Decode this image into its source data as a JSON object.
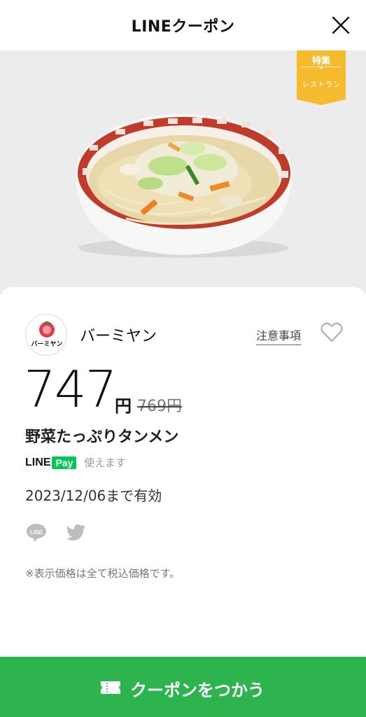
{
  "header": {
    "title": "LINEクーポン",
    "close_icon": "close-icon"
  },
  "hero": {
    "image": "tanmen-bowl",
    "ribbon_top": "特集",
    "ribbon_bottom": "レストラン",
    "ribbon_color": "#f6ba2d"
  },
  "shop": {
    "name": "バーミヤン",
    "logo_text": "バーミヤン",
    "notice_label": "注意事項",
    "favorite_icon": "heart-icon"
  },
  "offer": {
    "price": "747",
    "currency": "円",
    "original_price": "769円",
    "item_name": "野菜たっぷりタンメン",
    "linepay_line": "LINE",
    "linepay_pay": "Pay",
    "linepay_note": "使えます",
    "expiry": "2023/12/06まで有効",
    "tax_note": "※表示価格は全て税込価格です。"
  },
  "share": {
    "line_icon": "line-share-icon",
    "line_icon_text": "LINE",
    "twitter_icon": "twitter-icon"
  },
  "cta": {
    "label": "クーポンをつかう",
    "icon": "ticket-icon",
    "color": "#2eb44e"
  }
}
